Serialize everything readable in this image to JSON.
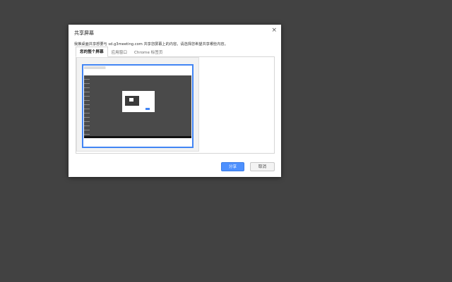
{
  "dialog": {
    "title": "共享屏幕",
    "description": "我推桌面共享想要与 sd.g3meeting.com 共享您屏幕上的内容。请选择您希望共享哪些内容。",
    "tabs": [
      {
        "label": "您的整个屏幕"
      },
      {
        "label": "应用窗口"
      },
      {
        "label": "Chrome 标签页"
      }
    ],
    "share_label": "分享",
    "cancel_label": "取消"
  },
  "colors": {
    "accent": "#4285f4",
    "backdrop": "#424242"
  }
}
